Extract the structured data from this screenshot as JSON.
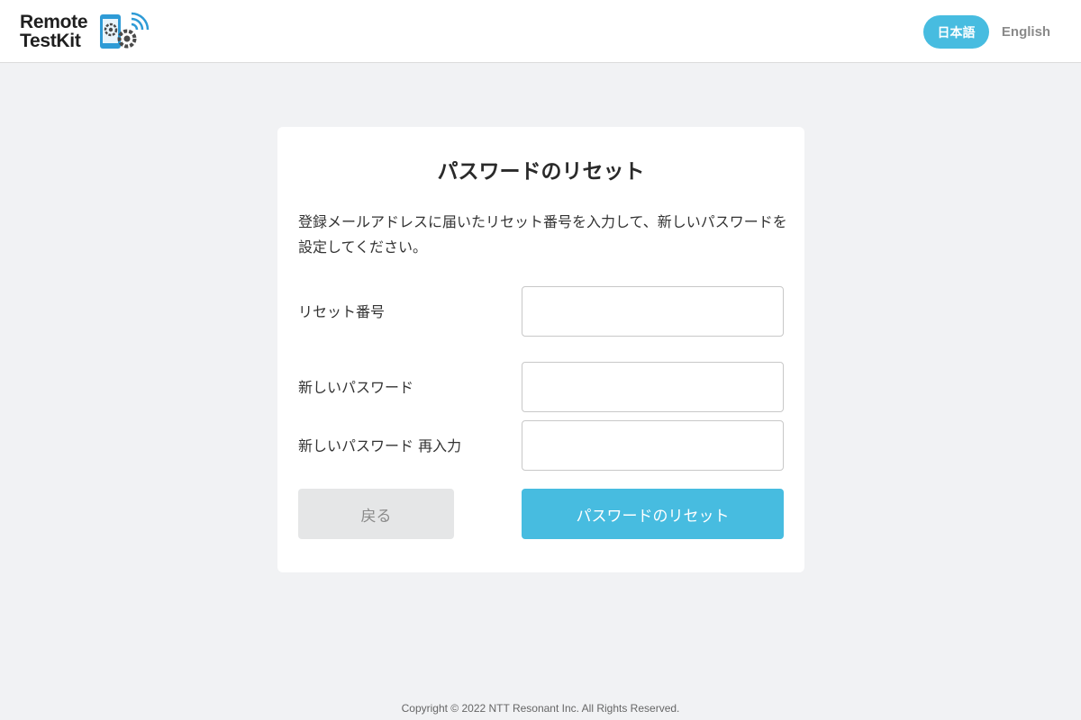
{
  "header": {
    "logo": {
      "line1": "Remote",
      "line2": "TestKit",
      "icon": "phone-gear-wifi-icon"
    },
    "languages": {
      "japanese": "日本語",
      "english": "English"
    }
  },
  "card": {
    "title": "パスワードのリセット",
    "description": "登録メールアドレスに届いたリセット番号を入力して、新しいパスワードを設定してください。",
    "fields": {
      "reset_code": {
        "label": "リセット番号",
        "value": ""
      },
      "new_password": {
        "label": "新しいパスワード",
        "value": ""
      },
      "confirm_password": {
        "label": "新しいパスワード 再入力",
        "value": ""
      }
    },
    "buttons": {
      "back": "戻る",
      "reset": "パスワードのリセット"
    }
  },
  "footer": {
    "copyright": "Copyright © 2022 NTT Resonant Inc. All Rights Reserved."
  },
  "colors": {
    "accent": "#47bce0",
    "page_bg": "#f1f2f4",
    "secondary_button": "#e5e6e7"
  }
}
